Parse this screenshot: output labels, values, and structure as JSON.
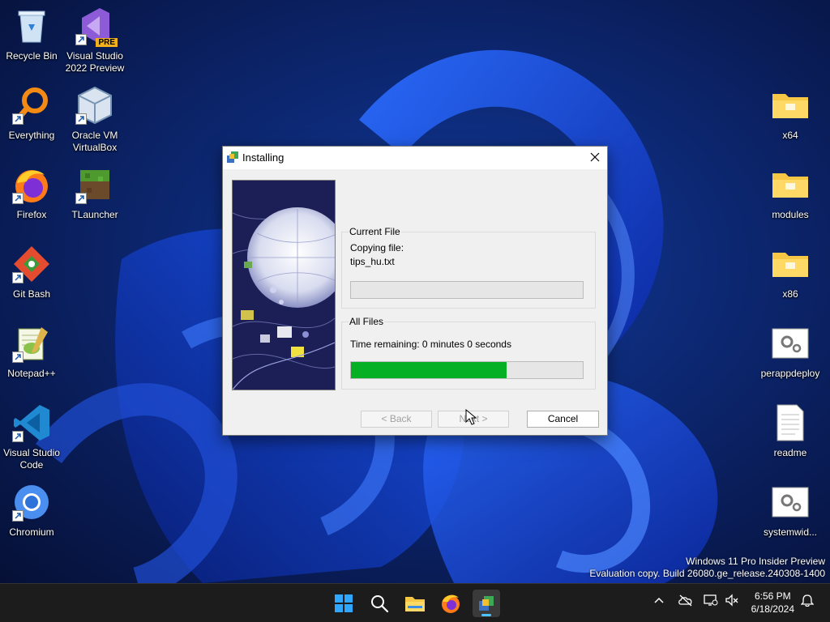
{
  "desktop": {
    "left_icons": [
      {
        "label": "Recycle Bin"
      },
      {
        "label": "Visual Studio 2022 Preview",
        "badge": "PRE"
      },
      {
        "label": "Everything"
      },
      {
        "label": "Oracle VM VirtualBox"
      },
      {
        "label": "Firefox"
      },
      {
        "label": "TLauncher"
      },
      {
        "label": "Git Bash"
      },
      {
        "label": "Notepad++"
      },
      {
        "label": "Visual Studio Code"
      },
      {
        "label": "Chromium"
      }
    ],
    "right_icons": [
      {
        "label": "x64"
      },
      {
        "label": "modules"
      },
      {
        "label": "x86"
      },
      {
        "label": "perappdeploy"
      },
      {
        "label": "readme"
      },
      {
        "label": "systemwid..."
      }
    ]
  },
  "dialog": {
    "title": "Installing",
    "current_file_group": "Current File",
    "copying_label": "Copying file:",
    "file_name": "tips_hu.txt",
    "current_progress": 0,
    "all_files_group": "All Files",
    "time_remaining": "Time remaining: 0 minutes 0 seconds",
    "all_progress": 0.67,
    "back_label": "< Back",
    "next_label": "Next >",
    "cancel_label": "Cancel"
  },
  "watermark": {
    "line1": "Windows 11 Pro Insider Preview",
    "line2": "Evaluation copy. Build 26080.ge_release.240308-1400"
  },
  "taskbar": {
    "time": "6:56 PM",
    "date": "6/18/2024",
    "accent": "#4cc2ff"
  },
  "colors": {
    "progress_fill": "#06b025",
    "folder": "#f6c744"
  }
}
